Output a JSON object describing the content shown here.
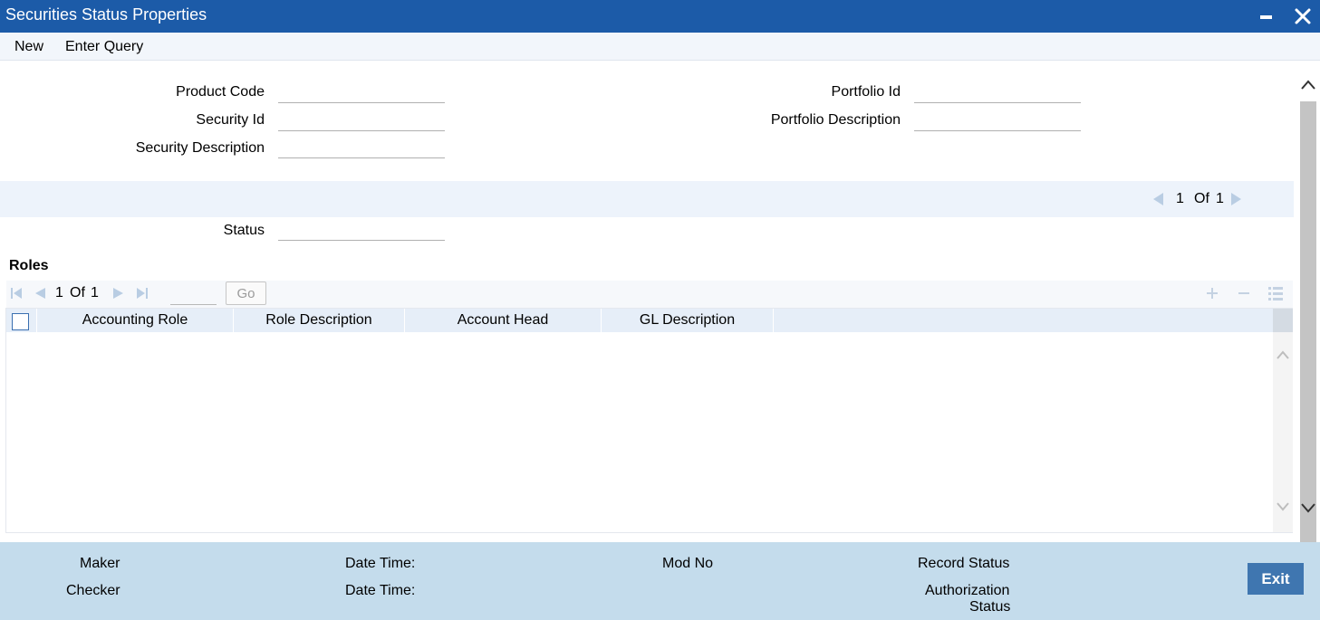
{
  "window": {
    "title": "Securities Status Properties",
    "minimize_icon": "minimize-icon",
    "close_icon": "close-icon",
    "title_bg": "#1c5ba8"
  },
  "menu": {
    "new_label": "New",
    "enter_query_label": "Enter Query"
  },
  "form": {
    "product_code_label": "Product Code",
    "product_code_value": "",
    "security_id_label": "Security Id",
    "security_id_value": "",
    "security_description_label": "Security Description",
    "security_description_value": "",
    "portfolio_id_label": "Portfolio Id",
    "portfolio_id_value": "",
    "portfolio_description_label": "Portfolio Description",
    "portfolio_description_value": "",
    "status_label": "Status",
    "status_value": ""
  },
  "record_pager": {
    "current": "1",
    "of_label": "Of",
    "total": "1"
  },
  "roles": {
    "title": "Roles",
    "pager": {
      "current": "1",
      "of_label": "Of",
      "total": "1",
      "go_label": "Go",
      "page_input": ""
    },
    "columns": [
      "Accounting Role",
      "Role Description",
      "Account Head",
      "GL Description"
    ],
    "rows": []
  },
  "footer": {
    "maker_label": "Maker",
    "checker_label": "Checker",
    "date_time_label_1": "Date Time:",
    "date_time_label_2": "Date Time:",
    "mod_no_label": "Mod No",
    "record_status_label": "Record Status",
    "authorization_label": "Authorization",
    "status_label": "Status",
    "exit_label": "Exit",
    "exit_color": "#3f76b0",
    "footer_bg": "#c4dcec"
  }
}
